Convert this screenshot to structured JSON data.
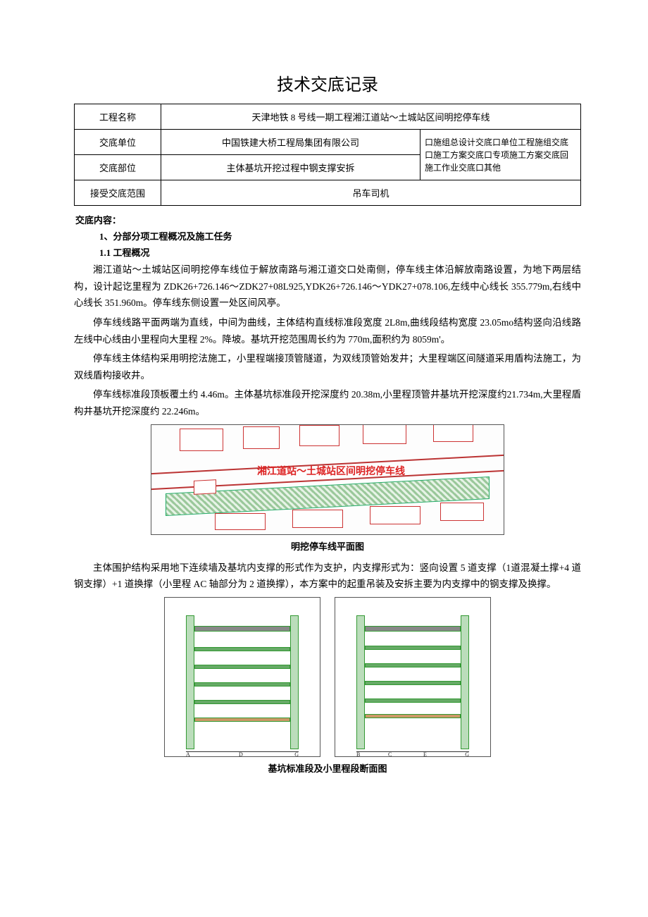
{
  "title": "技术交底记录",
  "table": {
    "r1_label": "工程名称",
    "r1_value": "天津地铁 8 号线一期工程湘江道站～土城站区间明挖停车线",
    "r2_label": "交底单位",
    "r2_value": "中国铁建大桥工程局集团有限公司",
    "r3_label": "交底部位",
    "r3_value": "主体基坑开挖过程中钢支撑安拆",
    "r4_label": "接受交底范围",
    "r4_value": "吊车司机",
    "check_line1": "口施组总设计交底口单位工程施组交底",
    "check_line2": "口施工方案交底口专项施工方案交底回",
    "check_line3": "施工作业交底口其他"
  },
  "content_heading": "交底内容：",
  "sec1": "1、分部分项工程概况及施工任务",
  "sec11": "1.1 工程概况",
  "p1": "湘江道站～土城站区间明挖停车线位于解放南路与湘江道交口处南侧，停车线主体沿解放南路设置，为地下两层结构，设计起讫里程为 ZDK26+726.146～ZDK27+08L925,YDK26+726.146～YDK27+078.106,左线中心线长 355.779m,右线中心线长 351.960m。停车线东侧设置一处区间风亭。",
  "p2": "停车线线路平面两端为直线，中间为曲线，主体结构直线标准段宽度 2L8m,曲线段结构宽度 23.05mo结构竖向沿线路左线中心线由小里程向大里程 2%。降坡。基坑开挖范围周长约为 770m,面积约为 8059m'。",
  "p3": "停车线主体结构采用明挖法施工，小里程端接顶管隧道，为双线顶管始发井；大里程端区间隧道采用盾构法施工，为双线盾构接收井。",
  "p4": "停车线标准段顶板覆土约 4.46m。主体基坑标准段开挖深度约 20.38m,小里程顶管井基坑开挖深度约21.734m,大里程盾构井基坑开挖深度约 22.246m。",
  "plan_label": "湘江道站～土城站区间明挖停车线",
  "figcap1": "明挖停车线平面图",
  "p5": "主体围护结构采用地下连续墙及基坑内支撑的形式作为支护，内支撑形式为：竖向设置 5 道支撑（1道混凝土撑+4 道钢支撑）+1 道换撑（小里程 AC 轴部分为 2 道换撑），本方案中的起重吊装及安拆主要为内支撑中的钢支撑及换撑。",
  "figcap2": "基坑标准段及小里程段断面图",
  "sect_axes_left": [
    "A",
    "D",
    "G"
  ],
  "sect_axes_right": [
    "B",
    "C",
    "E",
    "G"
  ]
}
